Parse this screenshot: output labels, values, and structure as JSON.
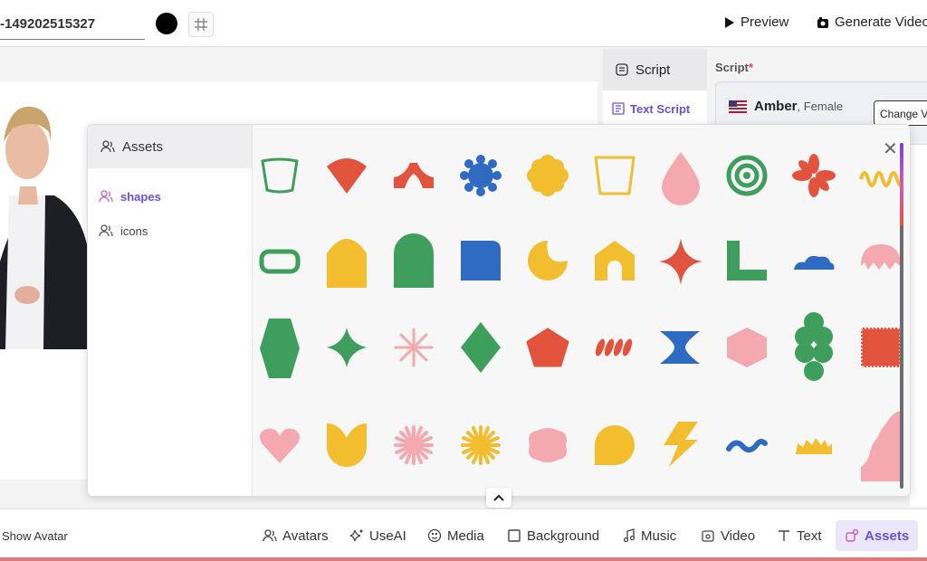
{
  "topbar": {
    "project_name": "-149202515327",
    "preview_label": "Preview",
    "generate_label": "Generate Video"
  },
  "script_panel": {
    "tab_label": "Script",
    "text_script_label": "Text Script",
    "script_label": "Script",
    "required_mark": "*",
    "voice_name": "Amber",
    "voice_gender": ", Female",
    "change_voice_label": "Change Voice"
  },
  "assets": {
    "header": "Assets",
    "categories": [
      {
        "label": "shapes",
        "active": true
      },
      {
        "label": "icons",
        "active": false
      }
    ],
    "shape_icons": [
      "rounded-trapezoid-outline-shape-icon",
      "semicircle-shape-icon",
      "chevron-shape-icon",
      "gear-flower-shape-icon",
      "flower-shape-icon",
      "trapezoid-outline-shape-icon",
      "drop-shape-icon",
      "target-shape-icon",
      "asterisk-shape-icon",
      "wave-shape-icon",
      "pill-outline-shape-icon",
      "arch-shape-icon",
      "arch-shape-icon",
      "rounded-square-shape-icon",
      "crescent-shape-icon",
      "house-shape-icon",
      "sparkle-shape-icon",
      "l-shape-icon",
      "cloud-shape-icon",
      "scalloped-dome-shape-icon",
      "hexagon-shape-icon",
      "four-point-star-shape-icon",
      "starburst-shape-icon",
      "diamond-shape-icon",
      "pentagon-shape-icon",
      "leaf-branch-shape-icon",
      "hourglass-shape-icon",
      "hexagon-shape-icon",
      "cloud-column-shape-icon",
      "stamp-shape-icon",
      "heart-shape-icon",
      "tulip-shape-icon",
      "starburst-shape-icon",
      "sunburst-shape-icon",
      "blob-shape-icon",
      "rounded-drop-shape-icon",
      "lightning-shape-icon",
      "squiggle-shape-icon",
      "crown-shape-icon",
      "stair-wave-shape-icon"
    ]
  },
  "bottombar": {
    "show_avatar_label": "Show Avatar",
    "tools": [
      {
        "label": "Avatars",
        "icon": "avatars-icon"
      },
      {
        "label": "UseAI",
        "icon": "ai-sparkle-icon"
      },
      {
        "label": "Media",
        "icon": "media-icon"
      },
      {
        "label": "Background",
        "icon": "background-icon"
      },
      {
        "label": "Music",
        "icon": "music-icon"
      },
      {
        "label": "Video",
        "icon": "video-icon"
      },
      {
        "label": "Text",
        "icon": "text-icon"
      },
      {
        "label": "Assets",
        "icon": "assets-icon",
        "active": true
      }
    ]
  },
  "colors": {
    "accent": "#6a4fd8",
    "green": "#3e9e5c",
    "red": "#e2533d",
    "blue": "#2f6bc2",
    "yellow": "#f2bd2f",
    "pink": "#f4a8b0"
  }
}
